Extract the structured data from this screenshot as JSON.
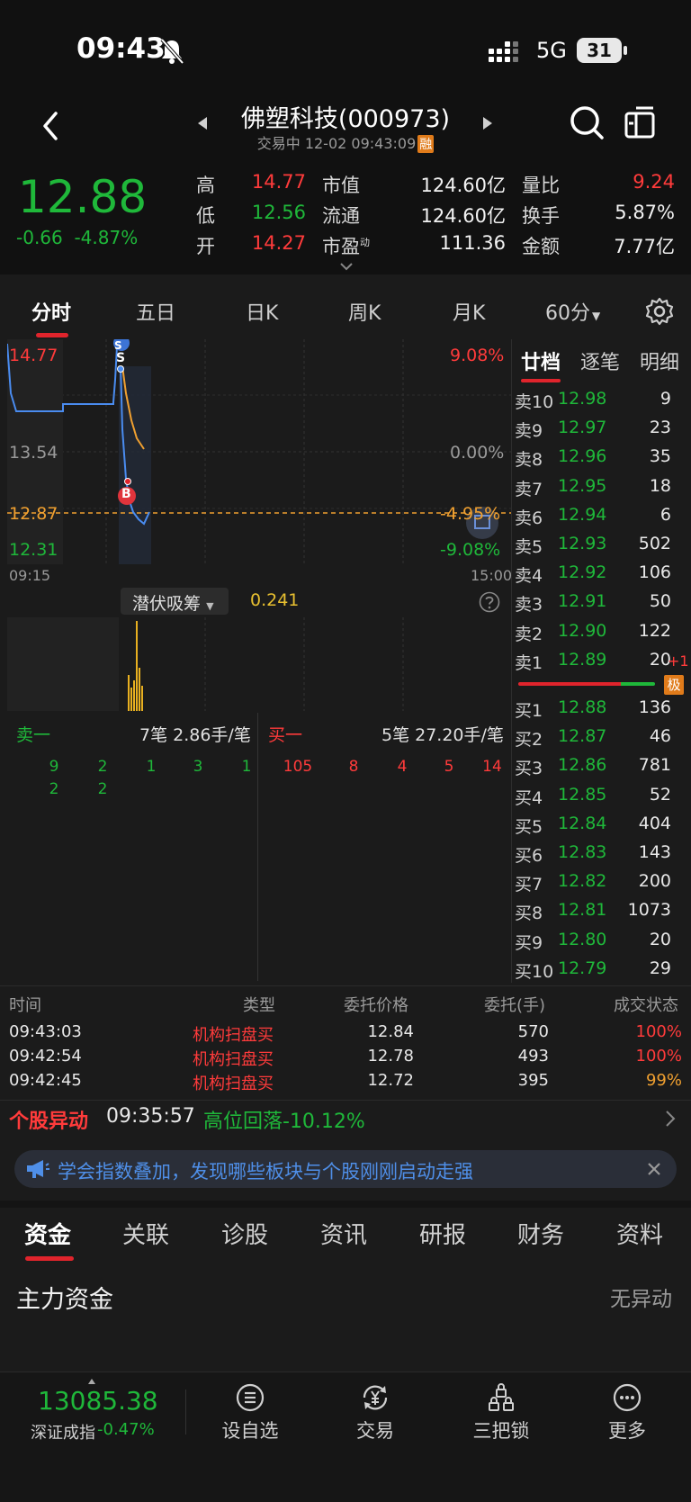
{
  "status_bar": {
    "time": "09:43",
    "network": "5G",
    "battery": "31"
  },
  "header": {
    "title": "佛塑科技(000973)",
    "trade_status": "交易中 12-02 09:43:09",
    "rong_badge": "融"
  },
  "quote": {
    "price": "12.88",
    "change": "-0.66",
    "change_pct": "-4.87%",
    "stats": [
      {
        "label": "高",
        "value": "14.77",
        "tone": "red"
      },
      {
        "label": "市值",
        "value": "124.60亿",
        "tone": "white"
      },
      {
        "label": "量比",
        "value": "9.24",
        "tone": "red"
      },
      {
        "label": "低",
        "value": "12.56",
        "tone": "green"
      },
      {
        "label": "流通",
        "value": "124.60亿",
        "tone": "white"
      },
      {
        "label": "换手",
        "value": "5.87%",
        "tone": "white"
      },
      {
        "label": "开",
        "value": "14.27",
        "tone": "red"
      },
      {
        "label": "市盈",
        "value": "111.36",
        "tone": "white"
      },
      {
        "label": "金额",
        "value": "7.77亿",
        "tone": "white"
      }
    ],
    "pe_superscript": "动"
  },
  "chart_tabs": [
    "分时",
    "五日",
    "日K",
    "周K",
    "月K",
    "60分"
  ],
  "intraday": {
    "price_high": "14.77",
    "price_mid": "13.54",
    "price_cur": "12.87",
    "price_low": "12.31",
    "pct_high": "9.08%",
    "pct_mid": "0.00%",
    "pct_cur": "-4.95%",
    "pct_low": "-9.08%",
    "time_start": "09:15",
    "time_end": "15:00",
    "marker_sell": "S",
    "marker_buy": "B",
    "indicator_name": "潜伏吸筹",
    "indicator_value": "0.241",
    "colors": {
      "price_line": "#4a8cf0",
      "avg_line": "#f0a030",
      "volume": "#e8b020"
    }
  },
  "queue": {
    "sell_label": "卖一",
    "sell_summary": "7笔 2.86手/笔",
    "sell_orders": [
      "9",
      "2",
      "1",
      "3",
      "1",
      "2",
      "2"
    ],
    "buy_label": "买一",
    "buy_summary": "5笔 27.20手/笔",
    "buy_orders": [
      "105",
      "8",
      "4",
      "5",
      "14"
    ]
  },
  "book": {
    "tabs": [
      "廿档",
      "逐笔",
      "明细"
    ],
    "asks": [
      {
        "label": "卖10",
        "price": "12.98",
        "vol": "9"
      },
      {
        "label": "卖9",
        "price": "12.97",
        "vol": "23"
      },
      {
        "label": "卖8",
        "price": "12.96",
        "vol": "35"
      },
      {
        "label": "卖7",
        "price": "12.95",
        "vol": "18"
      },
      {
        "label": "卖6",
        "price": "12.94",
        "vol": "6"
      },
      {
        "label": "卖5",
        "price": "12.93",
        "vol": "502"
      },
      {
        "label": "卖4",
        "price": "12.92",
        "vol": "106"
      },
      {
        "label": "卖3",
        "price": "12.91",
        "vol": "50"
      },
      {
        "label": "卖2",
        "price": "12.90",
        "vol": "122"
      },
      {
        "label": "卖1",
        "price": "12.89",
        "vol": "20"
      }
    ],
    "bids": [
      {
        "label": "买1",
        "price": "12.88",
        "vol": "136"
      },
      {
        "label": "买2",
        "price": "12.87",
        "vol": "46"
      },
      {
        "label": "买3",
        "price": "12.86",
        "vol": "781"
      },
      {
        "label": "买4",
        "price": "12.85",
        "vol": "52"
      },
      {
        "label": "买5",
        "price": "12.84",
        "vol": "404"
      },
      {
        "label": "买6",
        "price": "12.83",
        "vol": "143"
      },
      {
        "label": "买7",
        "price": "12.82",
        "vol": "200"
      },
      {
        "label": "买8",
        "price": "12.81",
        "vol": "1073"
      },
      {
        "label": "买9",
        "price": "12.80",
        "vol": "20"
      },
      {
        "label": "买10",
        "price": "12.79",
        "vol": "29"
      }
    ],
    "plus_one": "+1",
    "ji_badge": "极"
  },
  "monitor": {
    "headers": [
      "时间",
      "类型",
      "委托价格",
      "委托(手)",
      "成交状态"
    ],
    "rows": [
      {
        "time": "09:43:03",
        "type": "机构扫盘买",
        "price": "12.84",
        "qty": "570",
        "status": "100%"
      },
      {
        "time": "09:42:54",
        "type": "机构扫盘买",
        "price": "12.78",
        "qty": "493",
        "status": "100%"
      },
      {
        "time": "09:42:45",
        "type": "机构扫盘买",
        "price": "12.72",
        "qty": "395",
        "status": "99%"
      }
    ]
  },
  "alert": {
    "label": "个股异动",
    "time": "09:35:57",
    "text": "高位回落-10.12%"
  },
  "tip": {
    "text": "学会指数叠加，发现哪些板块与个股刚刚启动走强"
  },
  "info_tabs": [
    "资金",
    "关联",
    "诊股",
    "资讯",
    "研报",
    "财务",
    "资料"
  ],
  "main_funds": {
    "title": "主力资金",
    "status": "无异动"
  },
  "bottom_bar": {
    "index_value": "13085.38",
    "index_name": "深证成指",
    "index_change": "-0.47%",
    "buttons": [
      "设自选",
      "交易",
      "三把锁",
      "更多"
    ]
  }
}
